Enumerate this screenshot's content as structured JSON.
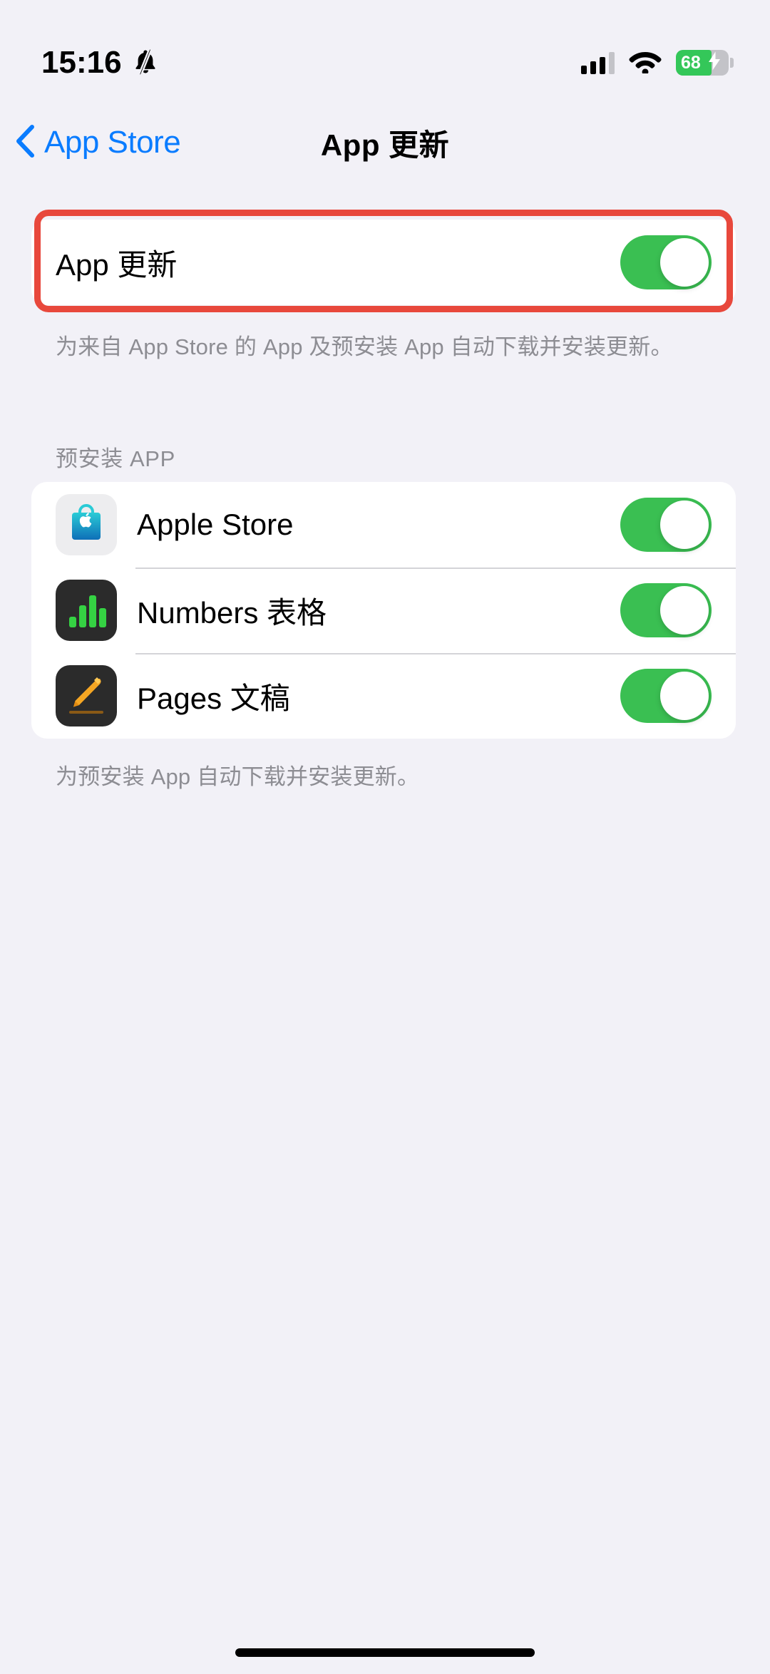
{
  "status_bar": {
    "time": "15:16",
    "mute_icon": "bell-slash-icon",
    "cellular_icon": "cellular-bars-icon",
    "wifi_icon": "wifi-icon",
    "battery_percent": "68",
    "battery_charging": true,
    "battery_fill_color": "#34C759"
  },
  "nav": {
    "back_label": "App Store",
    "back_icon": "chevron-left-icon",
    "title": "App 更新",
    "tint_color": "#0A7CFF"
  },
  "annotation": {
    "color": "#E8483C",
    "target": "app-update-row"
  },
  "main_setting": {
    "label": "App 更新",
    "toggle_on": true,
    "footer": "为来自 App Store 的 App 及预安装 App 自动下载并安装更新。"
  },
  "preinstalled_section": {
    "header": "预安装 APP",
    "footer": "为预安装 App 自动下载并安装更新。",
    "items": [
      {
        "label": "Apple Store",
        "icon": "apple-store-app-icon",
        "toggle_on": true
      },
      {
        "label": "Numbers 表格",
        "icon": "numbers-app-icon",
        "toggle_on": true
      },
      {
        "label": "Pages 文稿",
        "icon": "pages-app-icon",
        "toggle_on": true
      }
    ]
  },
  "colors": {
    "page_background": "#F2F1F7",
    "card_background": "#FFFFFF",
    "switch_on": "#3ABF52",
    "secondary_text": "#8D8D93"
  },
  "home_indicator": "home-indicator"
}
